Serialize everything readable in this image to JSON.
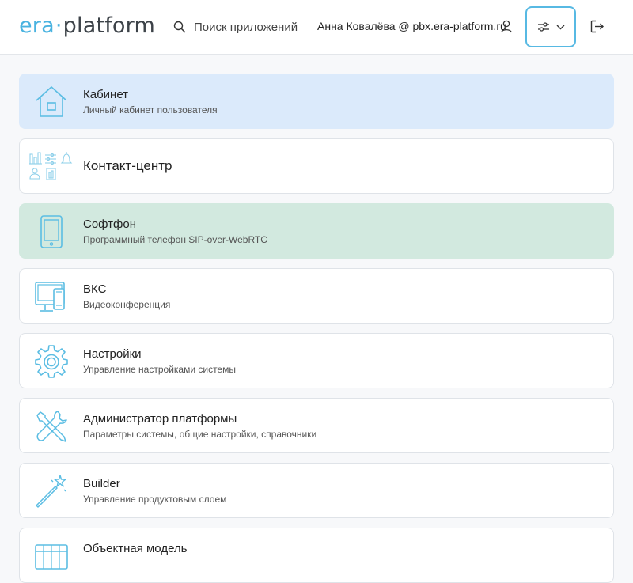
{
  "header": {
    "logo_era": "era",
    "logo_dot": "·",
    "logo_platform": "platform",
    "search_label": "Поиск приложений",
    "user_label": "Анна Ковалёва @ pbx.era-platform.ru",
    "icons": {
      "search": "search-icon",
      "user": "user-icon",
      "filter": "sliders-icon",
      "chevron": "chevron-down-icon",
      "logout": "logout-icon"
    }
  },
  "colors": {
    "accent": "#57b9e3",
    "icon": "#5bbde3",
    "card_blue": "#dbeafb",
    "card_green": "#d2e9df"
  },
  "apps": [
    {
      "title": "Кабинет",
      "subtitle": "Личный кабинет пользователя",
      "icon": "house-icon"
    },
    {
      "title": "Контакт-центр",
      "subtitle": "",
      "icon": "contact-center-icon"
    },
    {
      "title": "Софтфон",
      "subtitle": "Программный телефон SIP-over-WebRTC",
      "icon": "tablet-icon"
    },
    {
      "title": "ВКС",
      "subtitle": "Видеоконференция",
      "icon": "monitor-phone-icon"
    },
    {
      "title": "Настройки",
      "subtitle": "Управление настройками системы",
      "icon": "gear-icon"
    },
    {
      "title": "Администратор платформы",
      "subtitle": "Параметры системы, общие настройки, справочники",
      "icon": "tools-icon"
    },
    {
      "title": "Builder",
      "subtitle": "Управление продуктовым слоем",
      "icon": "magic-wand-icon"
    },
    {
      "title": "Объектная модель",
      "subtitle": "",
      "icon": "table-icon"
    }
  ]
}
